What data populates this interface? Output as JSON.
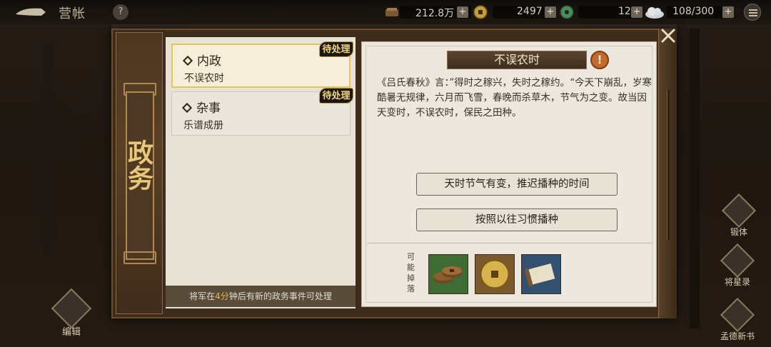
{
  "header": {
    "title": "营帐",
    "help_label": "?",
    "resources": [
      {
        "name": "provisions",
        "value": "212.8万",
        "plus": "+",
        "icon": "provisions-icon"
      },
      {
        "name": "copper",
        "value": "2497",
        "plus": "+",
        "icon": "jade-coin-icon"
      },
      {
        "name": "stamina",
        "value": "12",
        "plus": "+",
        "icon": "cloud-icon"
      },
      {
        "name": "troops",
        "value": "108/300",
        "plus": "+",
        "icon": ""
      }
    ]
  },
  "panel": {
    "banner_title": "政务",
    "close_icon": "close-icon"
  },
  "cases": [
    {
      "category": "内政",
      "title": "不误农时",
      "badge": "待处理",
      "active": true
    },
    {
      "category": "杂事",
      "title": "乐谱成册",
      "badge": "待处理",
      "active": false
    }
  ],
  "footer": {
    "prefix": "将军在",
    "minutes": "4分",
    "suffix": "钟后有新的政务事件可处理"
  },
  "event": {
    "title": "不误农时",
    "warn_label": "!",
    "text": "《吕氏春秋》言：”得时之稼兴，失时之稼约。“今天下崩乱，岁寒酷暑无规律，六月而飞雪，春晚而杀草木，节气为之变。故当因天变时，不误农时，保民之田种。",
    "choices": [
      "天时节气有变，推迟播种的时间",
      "按照以往习惯播种"
    ],
    "drop_label": "可能掉落",
    "drops": [
      {
        "icon": "copper-coins-icon",
        "color": "#3f6b35"
      },
      {
        "icon": "gold-coin-icon",
        "color": "#7a5a2c"
      },
      {
        "icon": "scroll-icon",
        "color": "#33506e"
      }
    ]
  },
  "side_menu": [
    {
      "label": "锻体",
      "icon": "armor-icon"
    },
    {
      "label": "将星录",
      "icon": "book-icon"
    },
    {
      "label": "孟德新书",
      "icon": "tome-icon"
    }
  ],
  "edit_label": "编辑"
}
